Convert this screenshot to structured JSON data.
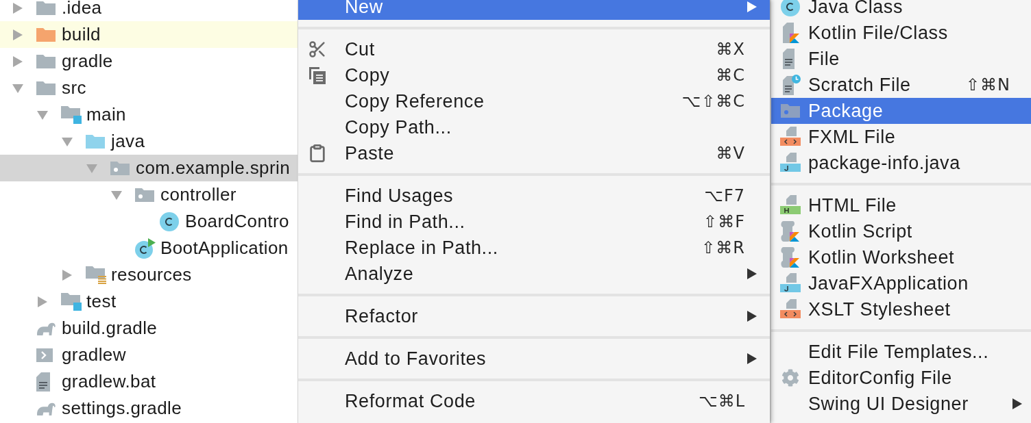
{
  "project_tree": {
    "items": [
      {
        "label": ".idea",
        "kind": "folder",
        "expanded": false,
        "selected": false,
        "highlighted": false
      },
      {
        "label": "build",
        "kind": "excluded-folder",
        "expanded": false,
        "selected": false,
        "highlighted": true
      },
      {
        "label": "gradle",
        "kind": "folder",
        "expanded": false,
        "selected": false,
        "highlighted": false
      },
      {
        "label": "src",
        "kind": "folder",
        "expanded": true,
        "selected": false,
        "highlighted": false,
        "children": [
          {
            "label": "main",
            "kind": "source-root",
            "expanded": true,
            "selected": false,
            "highlighted": false,
            "children": [
              {
                "label": "java",
                "kind": "sources-folder",
                "expanded": true,
                "selected": false,
                "highlighted": false,
                "children": [
                  {
                    "label": "com.example.sprin",
                    "kind": "package",
                    "expanded": true,
                    "selected": true,
                    "highlighted": false,
                    "children": [
                      {
                        "label": "controller",
                        "kind": "package",
                        "expanded": true,
                        "selected": false,
                        "highlighted": false,
                        "children": [
                          {
                            "label": "BoardContro",
                            "kind": "class",
                            "selected": false,
                            "highlighted": false
                          }
                        ]
                      },
                      {
                        "label": "BootApplication",
                        "kind": "main-class",
                        "selected": false,
                        "highlighted": false
                      }
                    ]
                  }
                ]
              },
              {
                "label": "resources",
                "kind": "resources-folder",
                "expanded": false,
                "selected": false,
                "highlighted": false
              }
            ]
          },
          {
            "label": "test",
            "kind": "source-root",
            "expanded": false,
            "selected": false,
            "highlighted": false
          }
        ]
      },
      {
        "label": "build.gradle",
        "kind": "gradle-file",
        "selected": false,
        "highlighted": false
      },
      {
        "label": "gradlew",
        "kind": "script-file",
        "selected": false,
        "highlighted": false
      },
      {
        "label": "gradlew.bat",
        "kind": "text-file",
        "selected": false,
        "highlighted": false
      },
      {
        "label": "settings.gradle",
        "kind": "gradle-file",
        "selected": false,
        "highlighted": false
      }
    ]
  },
  "context_menu": {
    "groups": [
      {
        "items": [
          {
            "label": "New",
            "kind": "plain",
            "selected": true,
            "submenu": true
          }
        ]
      },
      {
        "items": [
          {
            "label": "Cut",
            "kind": "cut",
            "shortcut": "⌘X",
            "selected": false,
            "submenu": false
          },
          {
            "label": "Copy",
            "kind": "copy",
            "shortcut": "⌘C",
            "selected": false,
            "submenu": false
          },
          {
            "label": "Copy Reference",
            "kind": "plain",
            "shortcut": "⌥⇧⌘C",
            "selected": false,
            "submenu": false
          },
          {
            "label": "Copy Path...",
            "kind": "plain",
            "selected": false,
            "submenu": false
          },
          {
            "label": "Paste",
            "kind": "paste",
            "shortcut": "⌘V",
            "selected": false,
            "submenu": false
          }
        ]
      },
      {
        "items": [
          {
            "label": "Find Usages",
            "kind": "plain",
            "shortcut": "⌥F7",
            "selected": false,
            "submenu": false
          },
          {
            "label": "Find in Path...",
            "kind": "plain",
            "shortcut": "⇧⌘F",
            "selected": false,
            "submenu": false
          },
          {
            "label": "Replace in Path...",
            "kind": "plain",
            "shortcut": "⇧⌘R",
            "selected": false,
            "submenu": false
          },
          {
            "label": "Analyze",
            "kind": "plain",
            "selected": false,
            "submenu": true
          }
        ]
      },
      {
        "items": [
          {
            "label": "Refactor",
            "kind": "plain",
            "selected": false,
            "submenu": true
          }
        ]
      },
      {
        "items": [
          {
            "label": "Add to Favorites",
            "kind": "plain",
            "selected": false,
            "submenu": true
          }
        ]
      },
      {
        "items": [
          {
            "label": "Reformat Code",
            "kind": "plain",
            "shortcut": "⌥⌘L",
            "selected": false,
            "submenu": false
          }
        ]
      }
    ]
  },
  "new_submenu": {
    "groups": [
      {
        "items": [
          {
            "label": "Java Class",
            "kind": "java-class",
            "selected": false,
            "submenu": false
          },
          {
            "label": "Kotlin File/Class",
            "kind": "kotlin-file",
            "selected": false,
            "submenu": false
          },
          {
            "label": "File",
            "kind": "file",
            "selected": false,
            "submenu": false
          },
          {
            "label": "Scratch File",
            "kind": "scratch-file",
            "shortcut": "⇧⌘N",
            "selected": false,
            "submenu": false
          },
          {
            "label": "Package",
            "kind": "package",
            "selected": true,
            "submenu": false
          },
          {
            "label": "FXML File",
            "kind": "fxml-file",
            "selected": false,
            "submenu": false
          },
          {
            "label": "package-info.java",
            "kind": "package-info",
            "selected": false,
            "submenu": false
          }
        ]
      },
      {
        "items": [
          {
            "label": "HTML File",
            "kind": "html-file",
            "selected": false,
            "submenu": false
          },
          {
            "label": "Kotlin Script",
            "kind": "kotlin-script",
            "selected": false,
            "submenu": false
          },
          {
            "label": "Kotlin Worksheet",
            "kind": "kotlin-worksheet",
            "selected": false,
            "submenu": false
          },
          {
            "label": "JavaFXApplication",
            "kind": "javafx-app",
            "selected": false,
            "submenu": false
          },
          {
            "label": "XSLT Stylesheet",
            "kind": "xslt-file",
            "selected": false,
            "submenu": false
          }
        ]
      },
      {
        "items": [
          {
            "label": "Edit File Templates...",
            "kind": "plain",
            "selected": false,
            "submenu": false
          },
          {
            "label": "EditorConfig File",
            "kind": "editorconfig",
            "selected": false,
            "submenu": false
          },
          {
            "label": "Swing UI Designer",
            "kind": "plain",
            "selected": false,
            "submenu": true
          }
        ]
      }
    ]
  }
}
